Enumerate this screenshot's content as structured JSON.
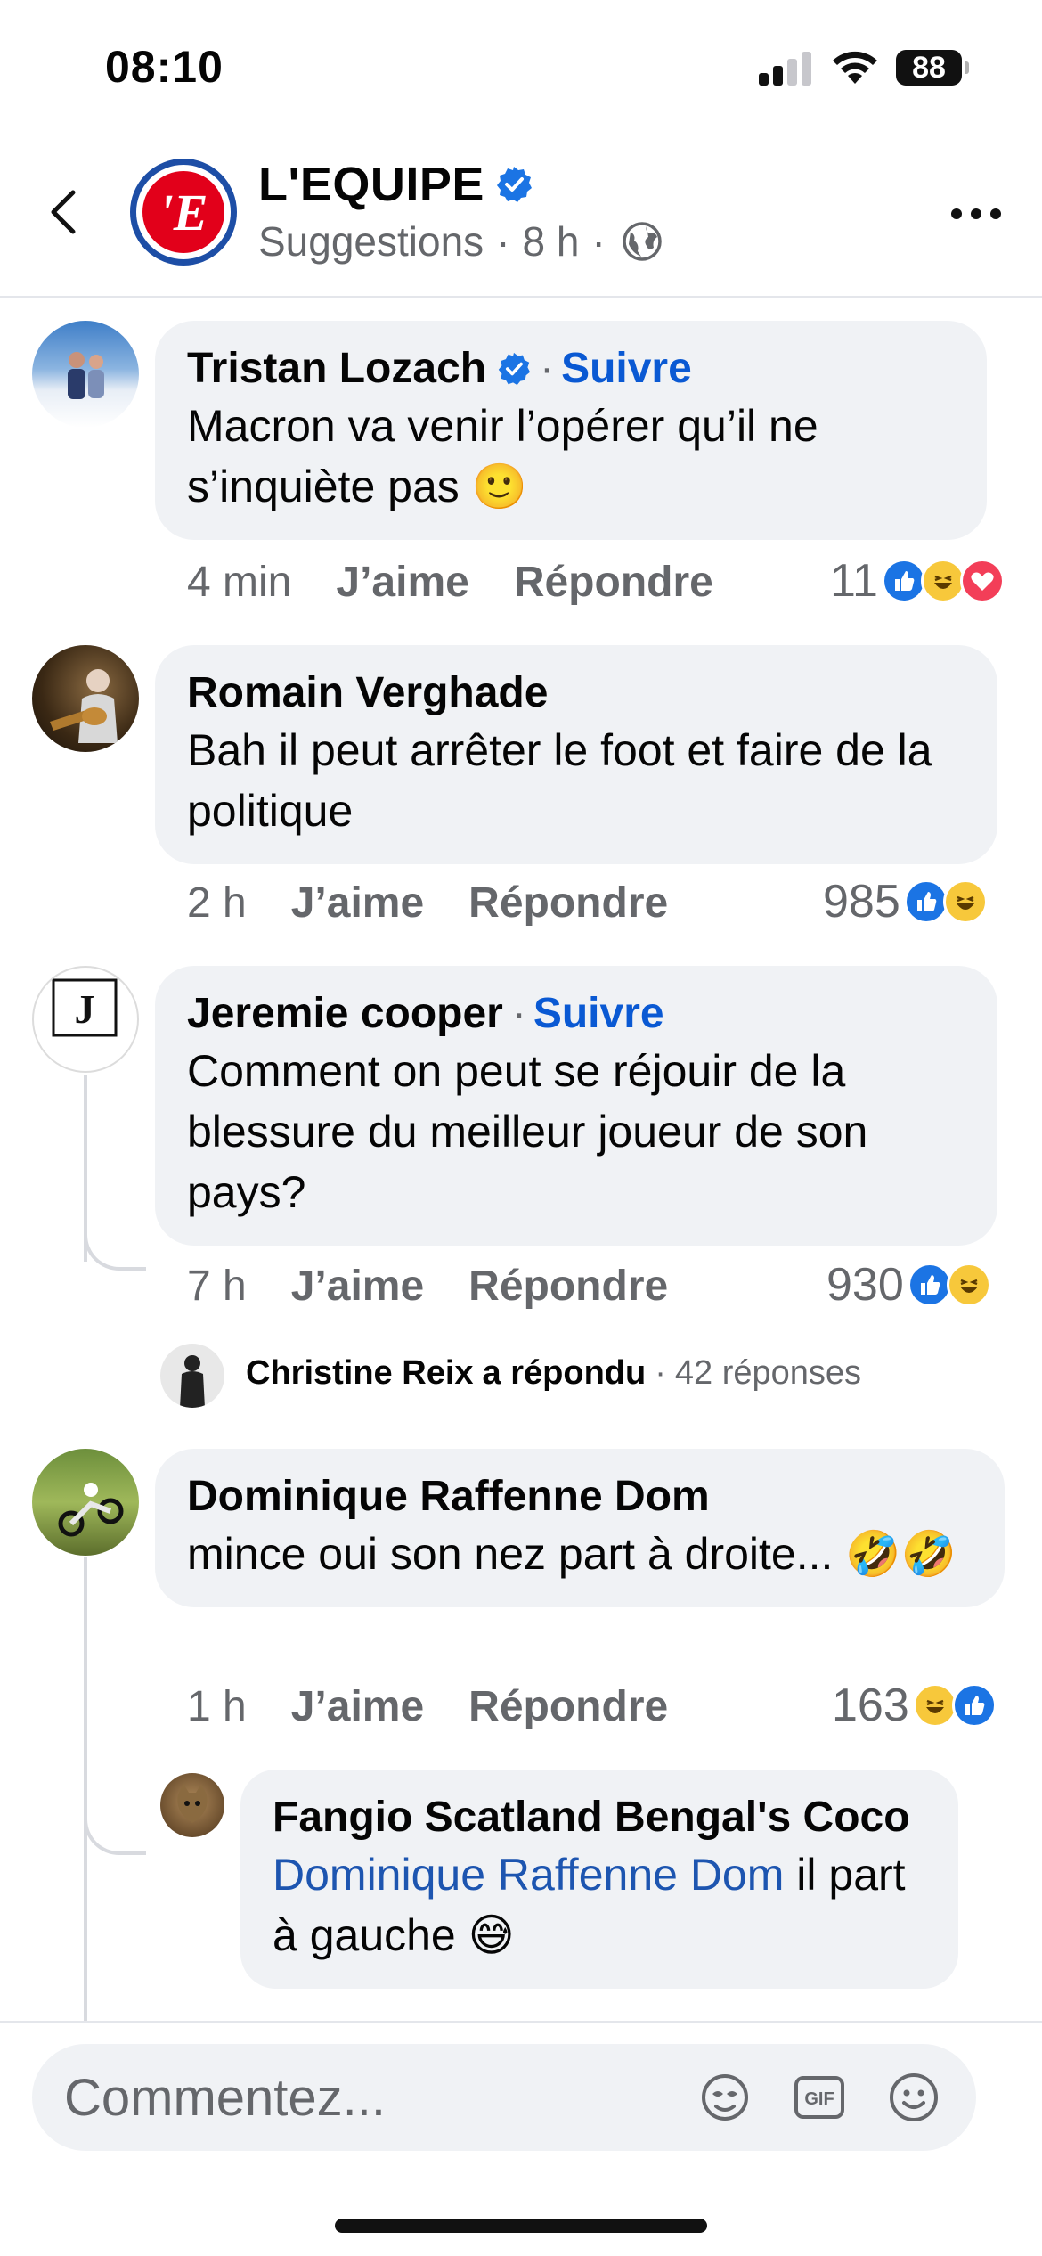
{
  "status_bar": {
    "time": "08:10",
    "battery": "88"
  },
  "header": {
    "page_name": "L'EQUIPE",
    "subtitle": "Suggestions",
    "age": "8 h",
    "logo_letter": "'E"
  },
  "comments": [
    {
      "author": "Tristan Lozach",
      "verified": true,
      "follow": "Suivre",
      "text": "Macron va venir l’opérer qu’il ne s’inquiète pas 🙂",
      "time": "4 min",
      "like_label": "J’aime",
      "reply_label": "Répondre",
      "reaction_count": "11",
      "reactions": [
        "like",
        "haha",
        "love"
      ]
    },
    {
      "author": "Romain Verghade",
      "text": "Bah il peut arrêter le foot et faire de la politique",
      "time": "2 h",
      "like_label": "J’aime",
      "reply_label": "Répondre",
      "reaction_count": "985",
      "reactions": [
        "like",
        "haha"
      ]
    },
    {
      "author": "Jeremie cooper",
      "follow": "Suivre",
      "text": "Comment on peut se réjouir de la blessure du meilleur joueur de son pays?",
      "time": "7 h",
      "like_label": "J’aime",
      "reply_label": "Répondre",
      "reaction_count": "930",
      "reactions": [
        "like",
        "haha"
      ],
      "replied": {
        "name": "Christine Reix",
        "verb": "a répondu",
        "count": "42 réponses"
      }
    },
    {
      "author": "Dominique Raffenne Dom",
      "text": "mince oui son nez part à droite... 🤣🤣",
      "time": "1 h",
      "like_label": "J’aime",
      "reply_label": "Répondre",
      "reaction_count": "163",
      "reactions": [
        "haha",
        "like"
      ],
      "reply": {
        "author": "Fangio Scatland Bengal's Coco",
        "mention": "Dominique Raffenne Dom",
        "text": " il part à gauche 😅"
      }
    }
  ],
  "composer": {
    "placeholder": "Commentez..."
  },
  "colors": {
    "accent": "#0a59d3",
    "like": "#1b74e4",
    "haha": "#f7c83b",
    "love": "#f33e58",
    "bubble": "#f0f2f5"
  },
  "icons": [
    "back-arrow-icon",
    "verified-badge-icon",
    "globe-icon",
    "more-icon",
    "avatar-frame-icon",
    "gif-icon",
    "emoji-icon"
  ]
}
